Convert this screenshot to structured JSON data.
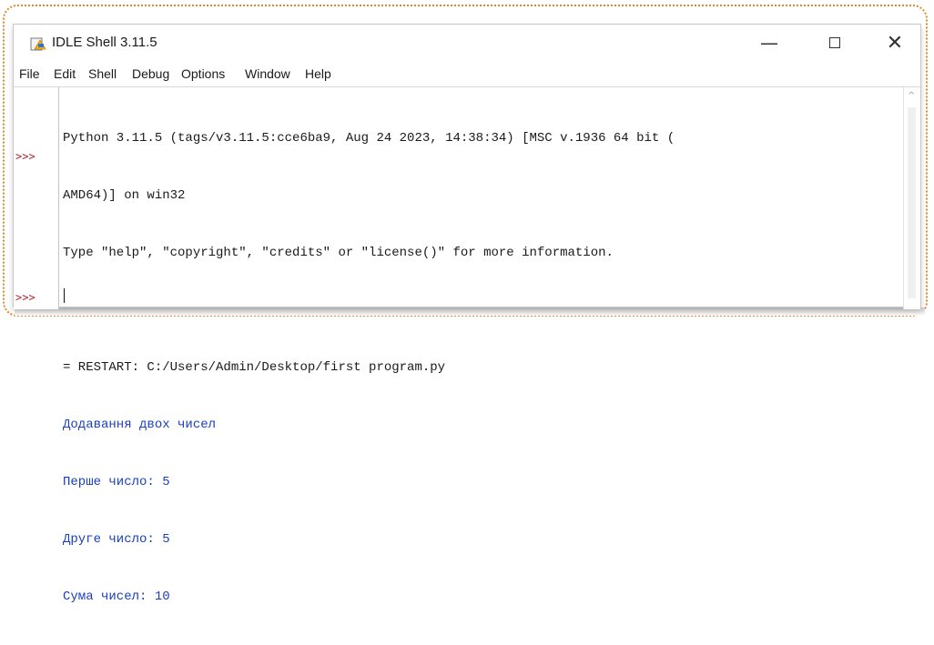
{
  "window": {
    "title": "IDLE Shell 3.11.5",
    "minimize_glyph": "—",
    "close_glyph": "✕"
  },
  "menu": [
    "File",
    "Edit",
    "Shell",
    "Debug",
    "Options",
    "Window",
    "Help"
  ],
  "gutter": {
    "prompt": ">>>"
  },
  "shell_lines": [
    "Python 3.11.5 (tags/v3.11.5:cce6ba9, Aug 24 2023, 14:38:34) [MSC v.1936 64 bit (",
    "AMD64)] on win32",
    "Type \"help\", \"copyright\", \"credits\" or \"license()\" for more information.",
    "",
    "= RESTART: C:/Users/Admin/Desktop/first program.py",
    "Додавання двох чисел",
    "Перше число: 5",
    "Друге число: 5",
    "Сума чисел: 10"
  ],
  "colors": {
    "output_text": "#1a3fbf",
    "prompt": "#b0272c",
    "frame_border": "#e08a2a"
  },
  "icons": {
    "app": "idle-python-icon",
    "scroll_up": "scroll-up-arrow-icon"
  }
}
